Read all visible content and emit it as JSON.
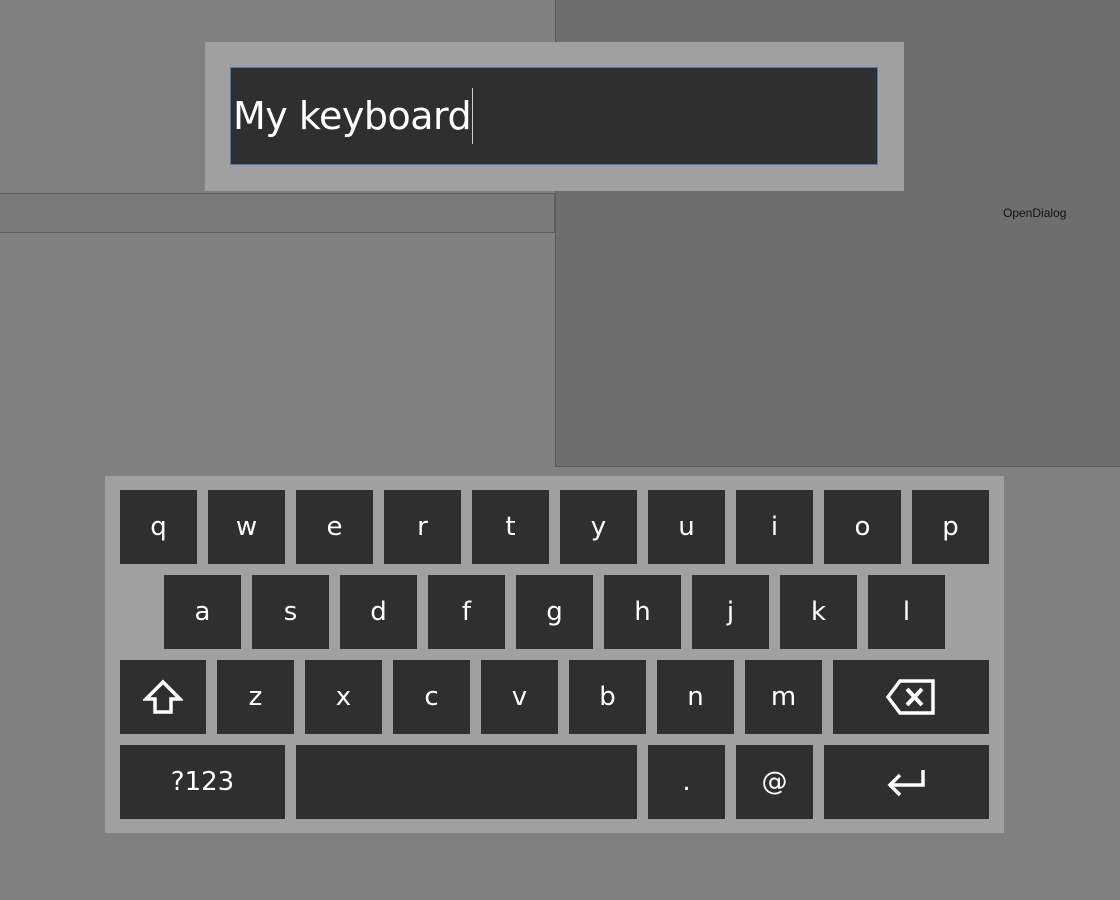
{
  "dialog": {
    "label": "OpenDialog"
  },
  "text_input": {
    "value": "My keyboard"
  },
  "keyboard": {
    "row1": [
      "q",
      "w",
      "e",
      "r",
      "t",
      "y",
      "u",
      "i",
      "o",
      "p"
    ],
    "row2": [
      "a",
      "s",
      "d",
      "f",
      "g",
      "h",
      "j",
      "k",
      "l"
    ],
    "row3": [
      "z",
      "x",
      "c",
      "v",
      "b",
      "n",
      "m"
    ],
    "symbols_label": "?123",
    "period_label": ".",
    "at_label": "@",
    "icons": {
      "shift": "shift-arrow-icon",
      "backspace": "backspace-icon",
      "enter": "enter-arrow-icon"
    }
  },
  "colors": {
    "background": "#808080",
    "right_panel": "#6e6e6e",
    "key": "#2f2f2f",
    "keyboard_frame": "#a0a0a0",
    "input_border": "#4a7bbd"
  }
}
